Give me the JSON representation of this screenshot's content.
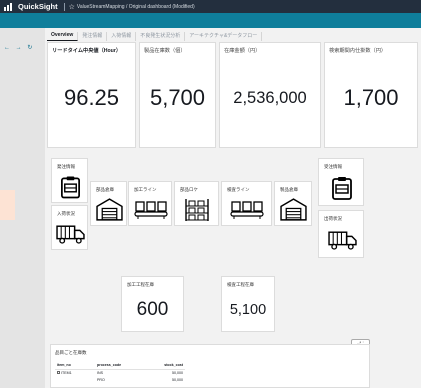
{
  "topbar": {
    "app_name": "QuickSight",
    "breadcrumb": "ValueStreamMapping / Original dashboard (Modified)"
  },
  "nav": {
    "icons": "← → ↻"
  },
  "tabs": [
    {
      "label": "Overview",
      "active": true
    },
    {
      "label": "発注情報"
    },
    {
      "label": "入荷情報"
    },
    {
      "label": "不良発生状況分析"
    },
    {
      "label": "アーキテクチャ&データフロー"
    }
  ],
  "kpis": [
    {
      "title": "リードタイム中央値（Hour）",
      "value": "96.25"
    },
    {
      "title": "製品在庫数（個）",
      "value": "5,700"
    },
    {
      "title": "在庫金額（円）",
      "value": "2,536,000"
    },
    {
      "title": "検索期間内仕掛数（円）",
      "value": "1,700"
    }
  ],
  "process": {
    "order_info": "発注情報",
    "receiving_status": "入荷状況",
    "parts_warehouse": "部品倉庫",
    "processing_line": "加工ライン",
    "parts_location": "部品ロケ",
    "inspection_line": "検査ライン",
    "product_warehouse": "製品倉庫",
    "received_order_info": "受注情報",
    "shipping_status": "出荷状況"
  },
  "wip": [
    {
      "title": "加工工程在庫",
      "value": "600"
    },
    {
      "title": "検査工程在庫",
      "value": "5,100"
    }
  ],
  "inventory_table": {
    "title": "品目ごと在庫数",
    "headers": [
      "item_no",
      "process_code",
      "stock_cost"
    ],
    "rows": [
      [
        "ITEM1",
        "INS",
        "50,000"
      ],
      [
        "",
        "PRO",
        "50,000"
      ]
    ]
  },
  "colors": {
    "header": "#232f3e",
    "teal": "#0f7e9b"
  }
}
